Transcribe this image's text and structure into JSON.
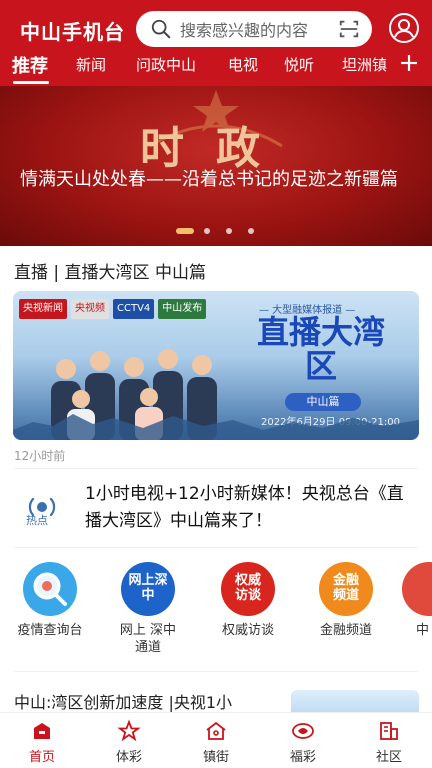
{
  "header": {
    "brand": "中山手机台",
    "search_placeholder": "搜索感兴趣的内容"
  },
  "tabs": [
    {
      "label": "推荐",
      "active": true
    },
    {
      "label": "新闻"
    },
    {
      "label": "问政中山"
    },
    {
      "label": "电视"
    },
    {
      "label": "悦听"
    },
    {
      "label": "坦洲镇"
    }
  ],
  "banner": {
    "title_art": "时政",
    "headline": "情满天山处处春——沿着总书记的足迹之新疆篇",
    "slide_count": 4,
    "active_slide": 1
  },
  "live_card": {
    "title": "直播 | 直播大湾区 中山篇",
    "poster": {
      "logos": [
        "央视新闻",
        "央视频",
        "CCTV4",
        "中山发布"
      ],
      "report_tag": "— 大型融媒体报道 —",
      "live_logo": "直播大湾区",
      "zs_tag": "中山篇",
      "date": "2022年6月29日 09:00-21:00"
    },
    "time_ago": "12小时前"
  },
  "hot_item": {
    "icon_label": "热点",
    "text": "1小时电视+12小时新媒体！央视总台《直播大湾区》中山篇来了！"
  },
  "quick_links": [
    {
      "label": "疫情查询台",
      "color": "#3aa7e8",
      "art": ""
    },
    {
      "label": "网上 深中通道",
      "color": "#1e63c9",
      "art": "网上深中"
    },
    {
      "label": "权威访谈",
      "color": "#d8261f",
      "art": "权威访谈"
    },
    {
      "label": "金融频道",
      "color": "#f08a1c",
      "art": "金融频道"
    },
    {
      "label": "中",
      "color": "#e04a3c",
      "art": ""
    }
  ],
  "news_item": {
    "title": "中山:湾区创新加速度 |央视1小"
  },
  "bottom_nav": [
    {
      "label": "首页",
      "icon": "home-icon",
      "active": true
    },
    {
      "label": "体彩",
      "icon": "star-icon"
    },
    {
      "label": "镇街",
      "icon": "house-icon"
    },
    {
      "label": "福彩",
      "icon": "welfare-icon"
    },
    {
      "label": "社区",
      "icon": "community-icon"
    }
  ],
  "colors": {
    "brand_red": "#c8151d",
    "banner_red": "#9c1412"
  }
}
